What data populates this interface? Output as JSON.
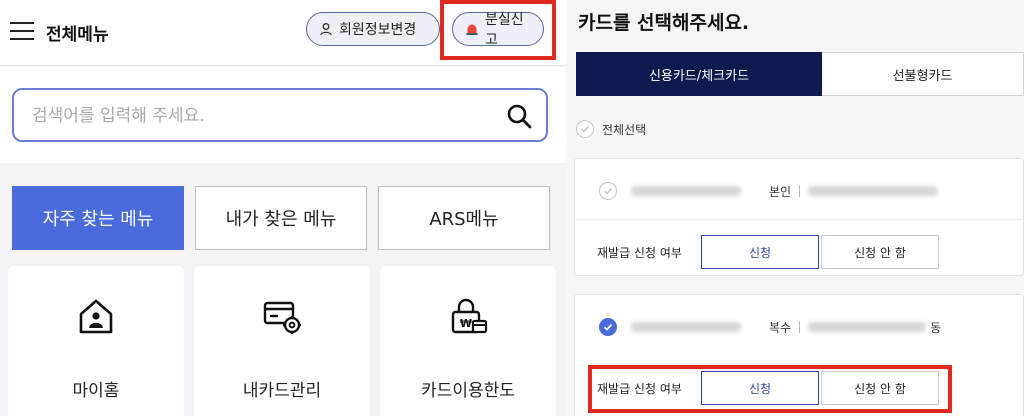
{
  "left": {
    "header": {
      "title": "전체메뉴",
      "member_info_label": "회원정보변경",
      "lost_report_label": "분실신고"
    },
    "search": {
      "placeholder": "검색어를 입력해 주세요."
    },
    "tabs": [
      {
        "label": "자주 찾는 메뉴",
        "active": true
      },
      {
        "label": "내가 찾은 메뉴",
        "active": false
      },
      {
        "label": "ARS메뉴",
        "active": false
      }
    ],
    "menu_cards": [
      {
        "label": "마이홈",
        "icon": "house-person-icon"
      },
      {
        "label": "내카드관리",
        "icon": "card-gear-icon"
      },
      {
        "label": "카드이용한도",
        "icon": "lock-won-card-icon"
      }
    ]
  },
  "right": {
    "title": "카드를 선택해주세요.",
    "segments": [
      {
        "label": "신용카드/체크카드",
        "active": true
      },
      {
        "label": "선불형카드",
        "active": false
      }
    ],
    "select_all_label": "전체선택",
    "cards": [
      {
        "checked": false,
        "owner": "본인",
        "suffix": "",
        "reissue_label": "재발급 신청 여부",
        "apply_label": "신청",
        "decline_label": "신청 안 함"
      },
      {
        "checked": true,
        "owner": "복수",
        "suffix": "동",
        "reissue_label": "재발급 신청 여부",
        "apply_label": "신청",
        "decline_label": "신청 안 함"
      }
    ]
  },
  "colors": {
    "accent_blue": "#4a6bdc",
    "navy": "#0c1a4d",
    "highlight_red": "#e0281f",
    "lost_icon_red": "#e8453c"
  }
}
